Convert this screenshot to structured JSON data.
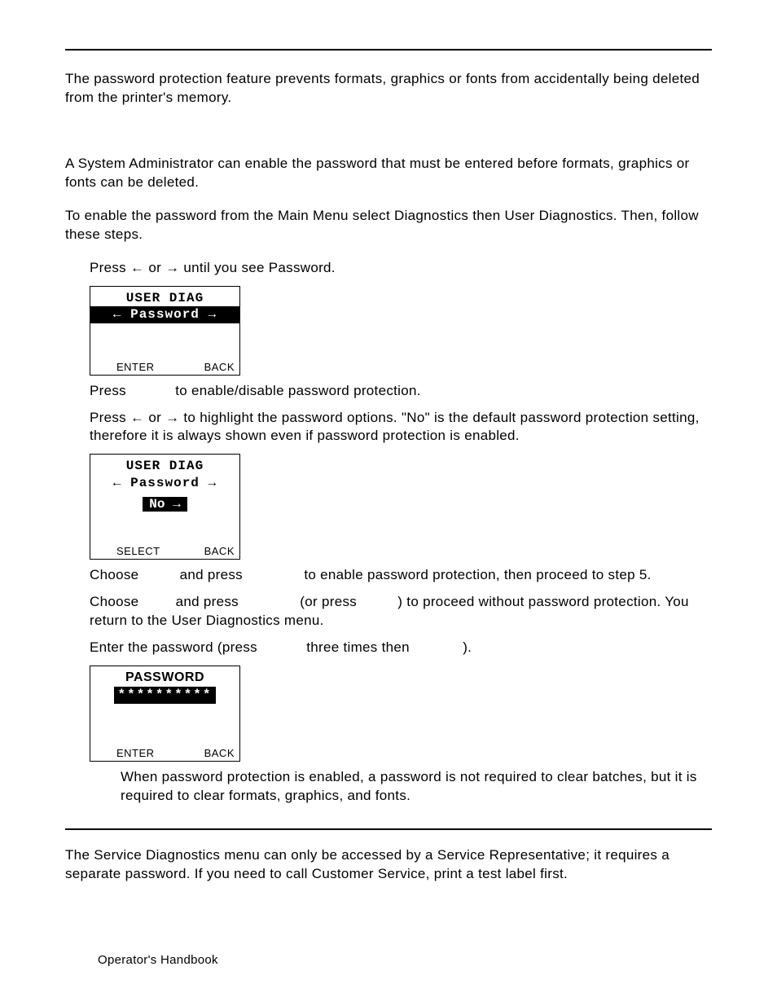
{
  "intro": "The password protection feature prevents formats, graphics or fonts from accidentally being deleted from the printer's memory.",
  "admin": "A System Administrator can enable the password that must be entered before formats, graphics or fonts can be deleted.",
  "enable": "To enable the password from the Main Menu select Diagnostics then User Diagnostics. Then, follow these steps.",
  "step1_a": "Press ",
  "step1_b": " or ",
  "step1_c": " until you see Password.",
  "arrow_left": "←",
  "arrow_right": "→",
  "lcd1": {
    "line1": "USER DIAG",
    "line2": "← Password →",
    "soft_left": "ENTER",
    "soft_right": "BACK"
  },
  "step2": "Press            to enable/disable password protection.",
  "step3_a": "Press ",
  "step3_b": " or ",
  "step3_c": " to highlight the password options.  \"No\" is the default password protection setting, therefore it is always shown even if password protection is enabled.",
  "lcd2": {
    "line1": "USER DIAG",
    "line2": "← Password →",
    "line3": "No →",
    "soft_left": "SELECT",
    "soft_right": "BACK"
  },
  "step4a": "Choose          and press               to enable password protection, then proceed to step 5.",
  "step4b": "Choose         and press               (or press          ) to proceed without password protection. You return to the User Diagnostics menu.",
  "step5": "Enter the password (press            three times then             ).",
  "lcd3": {
    "line1": "PASSWORD",
    "line2": "**********",
    "soft_left": "ENTER",
    "soft_right": "BACK"
  },
  "note": "When password protection is enabled, a password is not required to clear batches, but it is required to clear formats, graphics, and fonts.",
  "service": "The Service Diagnostics menu can only be accessed by a Service Representative; it requires a separate password.  If you need to call Customer Service, print a test label first.",
  "footer": "Operator's Handbook"
}
